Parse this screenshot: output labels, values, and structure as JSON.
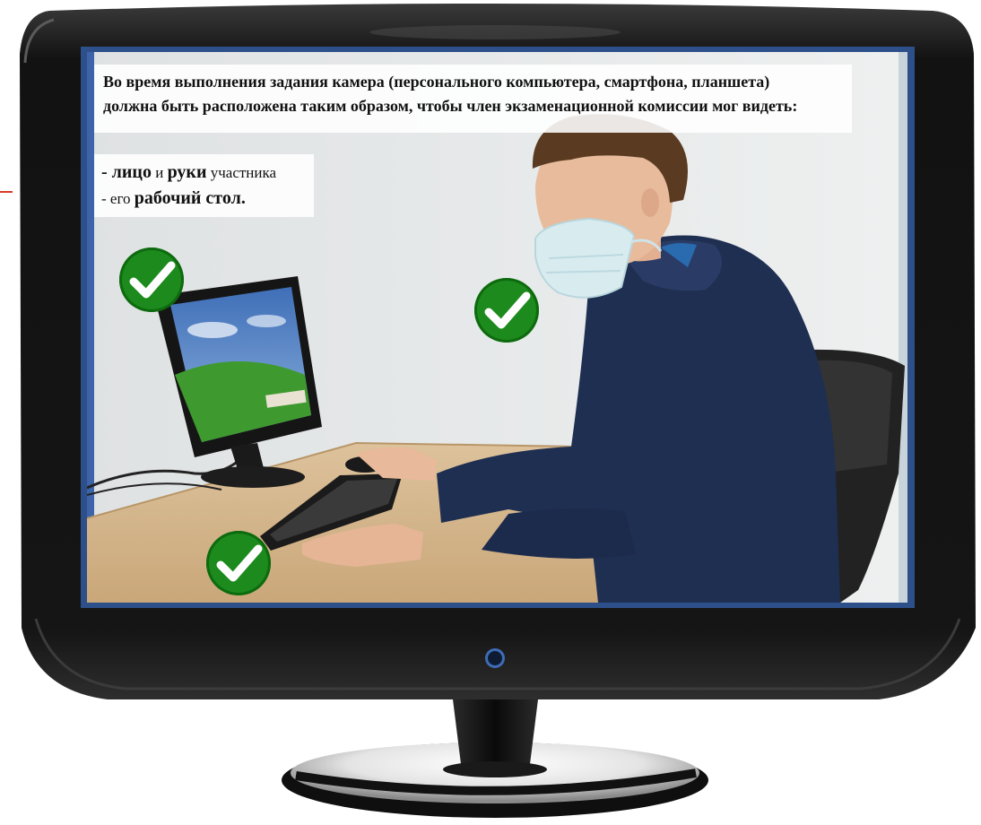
{
  "instruction": {
    "line1": "Во время выполнения задания камера (персонального компьютера, смартфона, планшета)",
    "line2": "должна быть расположена таким образом, чтобы член экзаменационной комиссии мог видеть:"
  },
  "requirements": {
    "item1": {
      "dash": "- ",
      "face": "лицо",
      "and": " и ",
      "hands": "руки",
      "rest": " участника"
    },
    "item2": {
      "dash": "- его ",
      "desk": "рабочий стол."
    }
  },
  "icons": {
    "check_monitor": "checkmark-icon",
    "check_face": "checkmark-icon",
    "check_keyboard": "checkmark-icon",
    "power": "power-button-icon"
  },
  "colors": {
    "check_green": "#1c8a1c",
    "bezel": "#141414",
    "wall": "#e4e6e6",
    "desk": "#d7b88f",
    "hoodie": "#1f2f52"
  }
}
